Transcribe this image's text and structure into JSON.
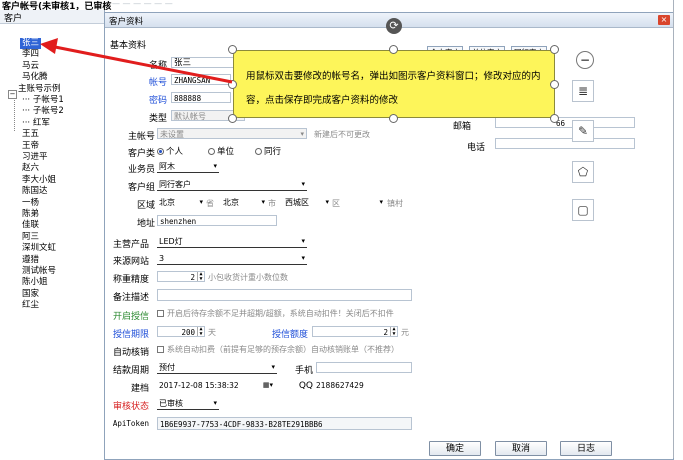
{
  "top_strip": {
    "title": "客户帐号(未审核1，已审核",
    "faded_text": "—  —  —  —  —  —"
  },
  "left_panel": {
    "header": "客户",
    "items": [
      {
        "label": "张三",
        "selected": true
      },
      {
        "label": "李四"
      },
      {
        "label": "马云"
      },
      {
        "label": "马化腾"
      },
      {
        "label": "主账号示例",
        "group": true
      },
      {
        "label": "子帐号1",
        "child": true
      },
      {
        "label": "子帐号2",
        "child": true
      },
      {
        "label": "红军",
        "child": true
      },
      {
        "label": "王五"
      },
      {
        "label": "王帝"
      },
      {
        "label": "习进平"
      },
      {
        "label": "赵六"
      },
      {
        "label": "李大小姐"
      },
      {
        "label": "陈国达"
      },
      {
        "label": "一杨"
      },
      {
        "label": "陈弟"
      },
      {
        "label": "佳联"
      },
      {
        "label": "阿三"
      },
      {
        "label": "深圳文虹"
      },
      {
        "label": "遵猎"
      },
      {
        "label": "测试帐号"
      },
      {
        "label": "陈小姐"
      },
      {
        "label": "国家"
      },
      {
        "label": "红尘"
      }
    ]
  },
  "dialog": {
    "title": "客户资料",
    "close_icon": "×",
    "rotate_icon": "⟳",
    "section": "基本资料",
    "fields": {
      "name_label": "名称",
      "name_value": "张三",
      "account_label": "帐号",
      "account_value": "ZHANGSAN",
      "password_label": "密码",
      "password_value": "888888",
      "type_label": "类型",
      "type_placeholder": "默认帐号",
      "master_label": "主帐号",
      "master_value": "未设置",
      "master_hint": "新建后不可更改",
      "ctype_label": "客户类",
      "ctype_options": [
        "个人",
        "单位",
        "同行"
      ],
      "sales_label": "业务员",
      "sales_value": "阿木",
      "group_label": "客户组",
      "group_value": "同行客户",
      "region_label": "区域",
      "province": "北京",
      "province_unit": "省",
      "city": "北京",
      "city_unit": "市",
      "district": "西城区",
      "district_unit": "区",
      "town_unit": "镇村",
      "address_label": "地址",
      "address_value": "shenzhen",
      "product_label": "主营产品",
      "product_value": "LED灯",
      "source_label": "来源网站",
      "source_value": "3",
      "precision_label": "称重精度",
      "precision_value": "2",
      "precision_hint": "小包收货计重小数位数",
      "remark_label": "备注描述",
      "credit_label": "开启授信",
      "credit_hint": "开启后待存余额不足并超期/超额，系统自动扣件！关闭后不扣件",
      "credit_days_label": "授信期限",
      "credit_days_value": "200",
      "credit_days_unit": "天",
      "credit_amount_label": "授信额度",
      "credit_amount_value": "2",
      "credit_amount_unit": "元",
      "auto_label": "自动核销",
      "auto_hint": "系统自动扣费（前提有足够的预存余额）自动核销账单（不推荐）",
      "settle_label": "结款周期",
      "settle_value": "预付",
      "mobile_label": "手机",
      "created_label": "建档",
      "created_value": "2017-12-08 15:38:32",
      "qq_label": "QQ",
      "qq_value": "2188627429",
      "audit_label": "审核状态",
      "audit_value": "已审核",
      "token_label": "ApiToken",
      "token_value": "1B6E9937-7753-4CDF-9833-B28TE291BBB6",
      "email_label": "邮箱",
      "email_value": "66",
      "phone_label": "电话"
    },
    "tabs": [
      "个人客户",
      "单位客户",
      "同行客户"
    ],
    "buttons": {
      "ok": "确定",
      "cancel": "取消",
      "log": "日志"
    }
  },
  "callout": {
    "text": "用鼠标双击要修改的帐号名，弹出如图示客户资料窗口；修改对应的内容，点击保存即完成客户资料的修改"
  },
  "toolbar": {
    "minus_icon": "−",
    "layout_icon": "≣",
    "pen_icon": "✎",
    "fill_icon": "⬠",
    "frame_icon": "▢"
  },
  "colors": {
    "arrow": "#e11d1d",
    "selection": "#2f64d6",
    "callout_fill": "#fdf55a",
    "blue_label": "#1f4fd8",
    "red_label": "#d62020",
    "green_label": "#2d8a32"
  }
}
